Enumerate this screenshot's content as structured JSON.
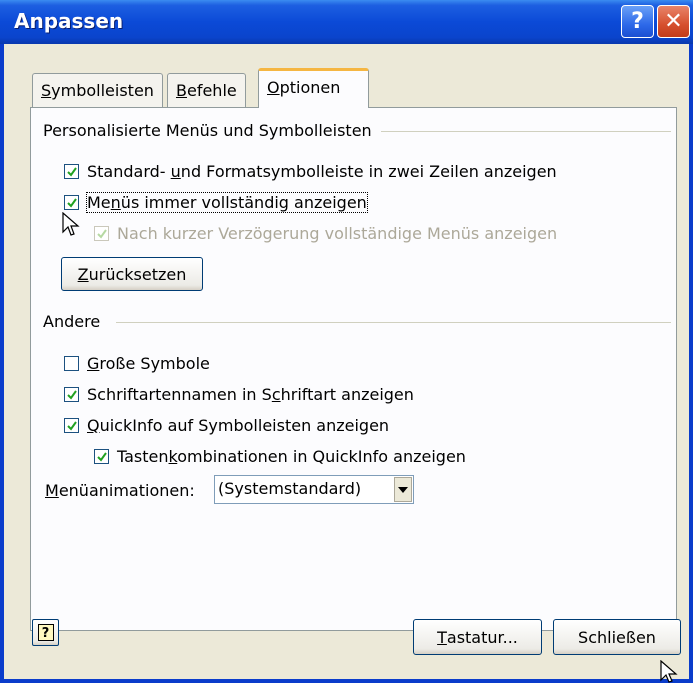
{
  "window": {
    "title": "Anpassen",
    "help_glyph": "?",
    "close_glyph": "✕"
  },
  "tabs": [
    {
      "pre": "",
      "u": "S",
      "post": "ymbolleisten"
    },
    {
      "pre": "",
      "u": "B",
      "post": "efehle"
    },
    {
      "pre": "",
      "u": "O",
      "post": "ptionen"
    }
  ],
  "personalized": {
    "title": "Personalisierte Menüs und Symbolleisten",
    "opt1": {
      "pre": "Standard- ",
      "u": "u",
      "post": "nd Formatsymbolleiste in zwei Zeilen anzeigen",
      "checked": true
    },
    "opt2": {
      "pre": "Me",
      "u": "n",
      "post": "üs immer vollständig anzeigen",
      "checked": true
    },
    "opt3": {
      "text": "Nach kurzer Verzögerung vollständige Menüs anzeigen",
      "checked": true,
      "disabled": true
    },
    "reset": {
      "pre": "",
      "u": "Z",
      "post": "urücksetzen"
    }
  },
  "other": {
    "title": "Andere",
    "opt1": {
      "pre": "",
      "u": "G",
      "post": "roße Symbole",
      "checked": false
    },
    "opt2": {
      "pre": "Schriftartennamen in S",
      "u": "c",
      "post": "hriftart anzeigen",
      "checked": true
    },
    "opt3": {
      "pre": "",
      "u": "Q",
      "post": "uickInfo auf Symbolleisten anzeigen",
      "checked": true
    },
    "opt4": {
      "pre": "Tasten",
      "u": "k",
      "post": "ombinationen in QuickInfo anzeigen",
      "checked": true
    },
    "anim_label": {
      "pre": "",
      "u": "M",
      "post": "enüanimationen:"
    },
    "anim_value": "(Systemstandard)"
  },
  "buttons": {
    "help_glyph": "?",
    "keyboard": {
      "pre": "",
      "u": "T",
      "post": "astatur..."
    },
    "close": "Schließen"
  }
}
